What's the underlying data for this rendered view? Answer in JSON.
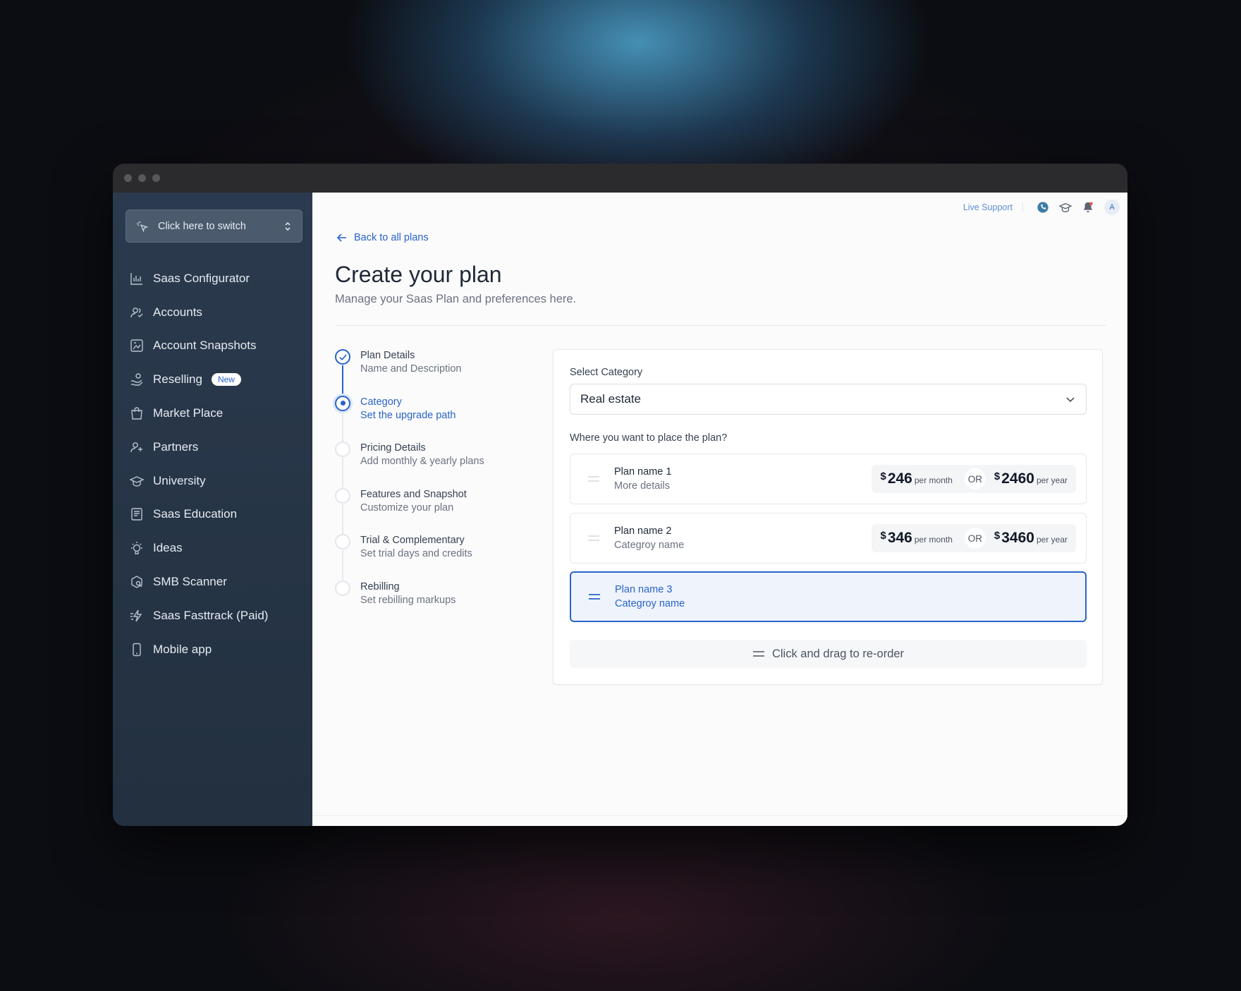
{
  "switcher": {
    "label": "Click here to switch"
  },
  "sidebar": {
    "items": [
      {
        "label": "Saas Configurator",
        "icon": "bar-chart-icon"
      },
      {
        "label": "Accounts",
        "icon": "users-icon"
      },
      {
        "label": "Account Snapshots",
        "icon": "snapshot-icon"
      },
      {
        "label": "Reselling",
        "icon": "hand-coins-icon",
        "badge": "New"
      },
      {
        "label": "Market Place",
        "icon": "shopping-bag-icon"
      },
      {
        "label": "Partners",
        "icon": "partners-icon"
      },
      {
        "label": "University",
        "icon": "graduation-cap-icon"
      },
      {
        "label": "Saas Education",
        "icon": "book-icon"
      },
      {
        "label": "Ideas",
        "icon": "lightbulb-icon"
      },
      {
        "label": "SMB Scanner",
        "icon": "scanner-icon"
      },
      {
        "label": "Saas Fasttrack (Paid)",
        "icon": "lightning-icon"
      },
      {
        "label": "Mobile app",
        "icon": "mobile-icon"
      }
    ]
  },
  "topbar": {
    "live_support": "Live Support",
    "avatar": "A"
  },
  "page": {
    "back": "Back to all plans",
    "title": "Create your plan",
    "subtitle": "Manage your Saas Plan and preferences here."
  },
  "steps": [
    {
      "title": "Plan Details",
      "desc": "Name and Description",
      "state": "done"
    },
    {
      "title": "Category",
      "desc": "Set the upgrade path",
      "state": "active"
    },
    {
      "title": "Pricing Details",
      "desc": "Add monthly & yearly plans",
      "state": "todo"
    },
    {
      "title": "Features and Snapshot",
      "desc": "Customize your plan",
      "state": "todo"
    },
    {
      "title": "Trial & Complementary",
      "desc": "Set trial days and credits",
      "state": "todo"
    },
    {
      "title": "Rebilling",
      "desc": "Set rebilling markups",
      "state": "todo"
    }
  ],
  "form": {
    "select_label": "Select Category",
    "select_value": "Real estate",
    "place_label": "Where you want to place the plan?",
    "plans": [
      {
        "name": "Plan name 1",
        "desc": "More details",
        "monthly": "246",
        "yearly": "2460",
        "currency": "$",
        "per_month": "per month",
        "per_year": "per year",
        "or": "OR"
      },
      {
        "name": "Plan name 2",
        "desc": "Categroy name",
        "monthly": "346",
        "yearly": "3460",
        "currency": "$",
        "per_month": "per month",
        "per_year": "per year",
        "or": "OR"
      },
      {
        "name": "Plan name 3",
        "desc": "Categroy name"
      }
    ],
    "drag_hint": "Click and drag to re-order"
  },
  "colors": {
    "accent": "#2a63c8",
    "sidebar": "#2b3a4e"
  }
}
